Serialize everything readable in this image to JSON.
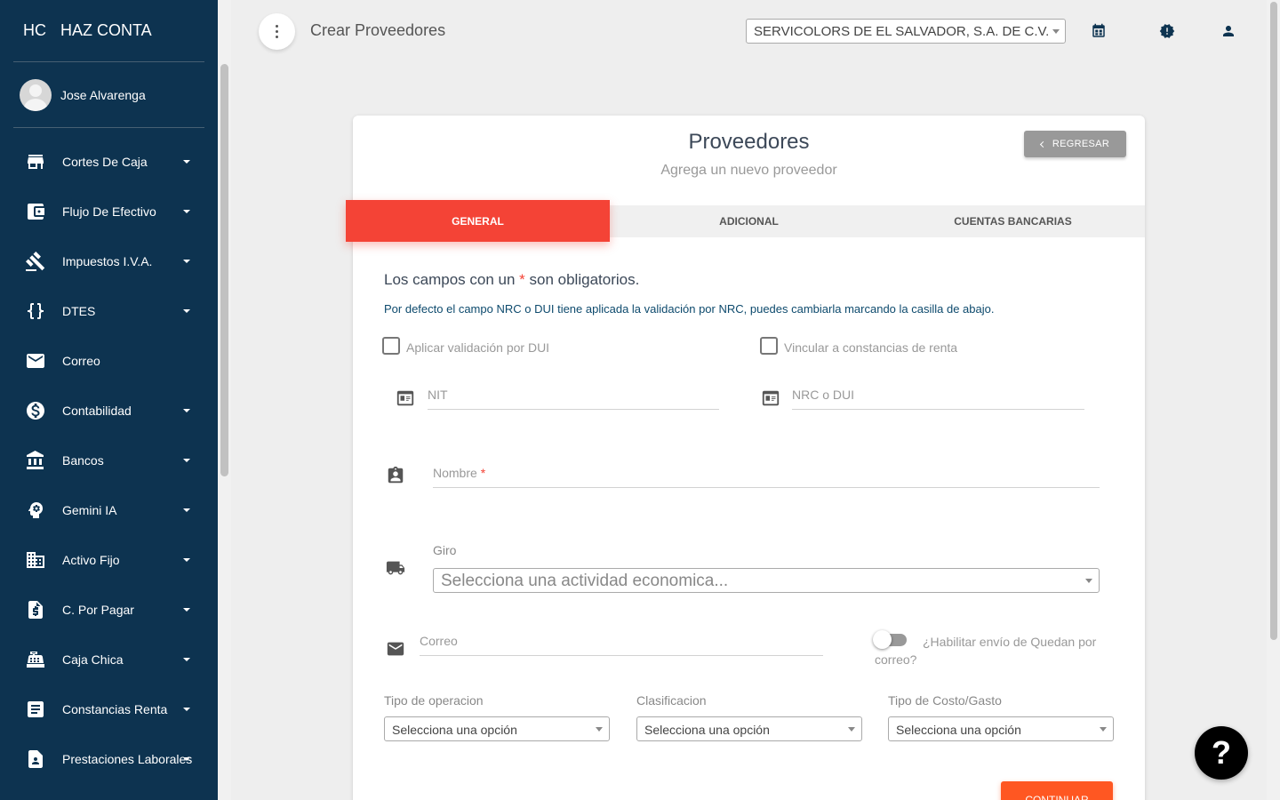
{
  "brand": {
    "mini": "HC",
    "full": "HAZ CONTA"
  },
  "user": {
    "name": "Jose Alvarenga"
  },
  "sidebar": {
    "items": [
      {
        "label": "Cortes De Caja",
        "icon": "store-icon",
        "has_caret": true
      },
      {
        "label": "Flujo De Efectivo",
        "icon": "wallet-icon",
        "has_caret": true
      },
      {
        "label": "Impuestos I.V.A.",
        "icon": "gavel-icon",
        "has_caret": true
      },
      {
        "label": "DTES",
        "icon": "code-braces-icon",
        "has_caret": true
      },
      {
        "label": "Correo",
        "icon": "mail-icon",
        "has_caret": false
      },
      {
        "label": "Contabilidad",
        "icon": "dollar-circle-icon",
        "has_caret": true
      },
      {
        "label": "Bancos",
        "icon": "bank-icon",
        "has_caret": true
      },
      {
        "label": "Gemini IA",
        "icon": "psychology-icon",
        "has_caret": true
      },
      {
        "label": "Activo Fijo",
        "icon": "building-icon",
        "has_caret": true
      },
      {
        "label": "C. Por Pagar",
        "icon": "request-quote-icon",
        "has_caret": true
      },
      {
        "label": "Caja Chica",
        "icon": "cash-register-icon",
        "has_caret": true
      },
      {
        "label": "Constancias Renta",
        "icon": "article-icon",
        "has_caret": true
      },
      {
        "label": "Prestaciones Laborales",
        "icon": "assignment-ind-icon",
        "has_caret": true
      }
    ]
  },
  "topbar": {
    "page_title": "Crear Proveedores",
    "company": "SERVICOLORS DE EL SALVADOR, S.A. DE C.V.",
    "icons": [
      "building-calendar-icon",
      "alert-badge-icon",
      "person-icon"
    ]
  },
  "card": {
    "title": "Proveedores",
    "subtitle": "Agrega un nuevo proveedor",
    "back_label": "REGRESAR",
    "tabs": [
      {
        "label": "GENERAL",
        "active": true
      },
      {
        "label": "ADICIONAL",
        "active": false
      },
      {
        "label": "CUENTAS BANCARIAS",
        "active": false
      }
    ],
    "required_note_pre": "Los campos con un",
    "required_star": "*",
    "required_note_post": "son obligatorios.",
    "info_note": "Por defecto el campo NRC o DUI tiene aplicada la validación por NRC, puedes cambiarla marcando la casilla de abajo.",
    "check_dui": "Aplicar validación por DUI",
    "check_renta": "Vincular a constancias de renta",
    "nit_placeholder": "NIT",
    "nrc_placeholder": "NRC o DUI",
    "nombre_placeholder": "Nombre",
    "giro_label": "Giro",
    "giro_placeholder": "Selecciona una actividad economica...",
    "correo_placeholder": "Correo",
    "quedan_toggle": "¿Habilitar envío de Quedan por correo?",
    "tipo_operacion_label": "Tipo de operacion",
    "clasificacion_label": "Clasificacion",
    "tipo_costo_label": "Tipo de Costo/Gasto",
    "select_placeholder": "Selecciona una opción",
    "continue_label": "CONTINUAR"
  },
  "help": {
    "label": "?"
  },
  "colors": {
    "sidebar": "#0d3350",
    "accent_tab": "#f44336",
    "continue": "#ff5722",
    "back_button": "#999999"
  }
}
